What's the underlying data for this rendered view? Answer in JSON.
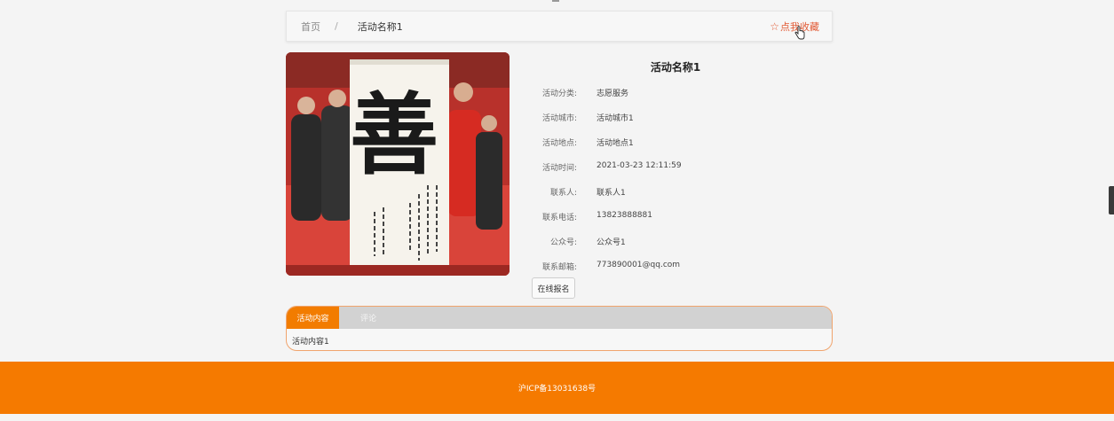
{
  "breadcrumb": {
    "home": "首页",
    "separator": "/",
    "current": "活动名称1"
  },
  "favorite": {
    "icon": "star-outline-icon",
    "label": "点我收藏"
  },
  "activity": {
    "title": "活动名称1",
    "fields": [
      {
        "label": "活动分类:",
        "value": "志愿服务"
      },
      {
        "label": "活动城市:",
        "value": "活动城市1"
      },
      {
        "label": "活动地点:",
        "value": "活动地点1"
      },
      {
        "label": "活动时间:",
        "value": "2021-03-23 12:11:59"
      },
      {
        "label": "联系人:",
        "value": "联系人1"
      },
      {
        "label": "联系电话:",
        "value": "13823888881"
      },
      {
        "label": "公众号:",
        "value": "公众号1"
      },
      {
        "label": "联系邮箱:",
        "value": "773890001@qq.com"
      }
    ],
    "signup_label": "在线报名",
    "image_glyph": "善"
  },
  "tabs": {
    "items": [
      {
        "label": "活动内容",
        "active": true
      },
      {
        "label": "评论",
        "active": false
      }
    ],
    "content": "活动内容1"
  },
  "footer": {
    "icp": "沪ICP备13031638号"
  },
  "colors": {
    "accent": "#f57a00",
    "favorite": "#e25a35",
    "tab_active": "#f27c00"
  }
}
